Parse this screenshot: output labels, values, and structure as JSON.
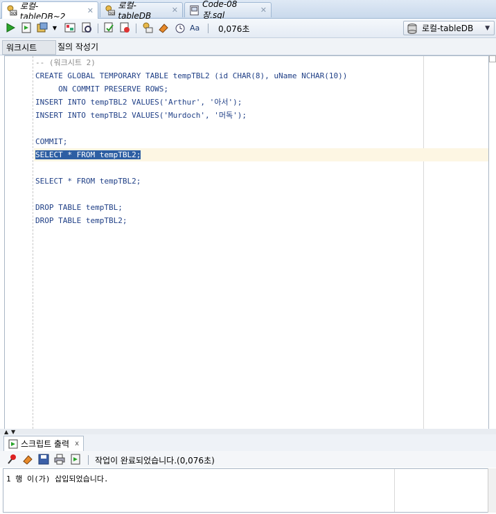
{
  "tabs": [
    {
      "label": "로컬-tableDB~2",
      "icon": "sql-worksheet-icon",
      "active": true
    },
    {
      "label": "로컬-tableDB",
      "icon": "sql-worksheet-icon",
      "active": false
    },
    {
      "label": "Code-08장.sql",
      "icon": "sql-file-icon",
      "active": false
    }
  ],
  "toolbar": {
    "timing": "0,076초",
    "connection": "로컬-tableDB"
  },
  "subtabs": [
    "워크시트",
    "질의 작성기"
  ],
  "editor": {
    "lines": [
      "-- (워크시트 2)",
      "CREATE GLOBAL TEMPORARY TABLE tempTBL2 (id CHAR(8), uName NCHAR(10))",
      "     ON COMMIT PRESERVE ROWS;",
      "INSERT INTO tempTBL2 VALUES('Arthur', '아서');",
      "INSERT INTO tempTBL2 VALUES('Murdoch', '머독');",
      "",
      "COMMIT;",
      "SELECT * FROM tempTBL2;",
      "",
      "SELECT * FROM tempTBL2;",
      "",
      "DROP TABLE tempTBL;",
      "DROP TABLE tempTBL2;"
    ]
  },
  "output": {
    "tab_label": "스크립트 출력",
    "status": "작업이 완료되었습니다.(0,076초)",
    "text": "1 행 이(가) 삽입되었습니다."
  },
  "colors": {
    "keyword": "#1f3f86",
    "selection": "#2d5ea3",
    "current_line": "#fdf6e3"
  }
}
